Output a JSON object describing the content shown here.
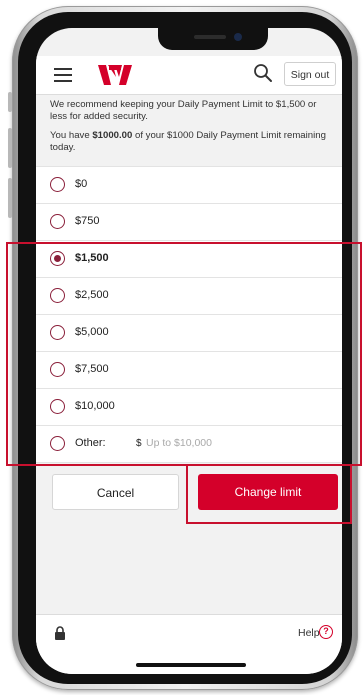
{
  "header": {
    "menu_icon": "hamburger-icon",
    "logo_icon": "westpac-logo-icon",
    "search_icon": "search-icon",
    "signout_label": "Sign out"
  },
  "intro": {
    "recommend_text": "We recommend keeping your Daily Payment Limit to $1,500 or less for added security.",
    "remaining_prefix": "You have ",
    "remaining_amount": "$1000.00",
    "remaining_suffix": " of your $1000 Daily Payment Limit remaining today."
  },
  "options": [
    {
      "label": "$0",
      "selected": false
    },
    {
      "label": "$750",
      "selected": false
    },
    {
      "label": "$1,500",
      "selected": true
    },
    {
      "label": "$2,500",
      "selected": false
    },
    {
      "label": "$5,000",
      "selected": false
    },
    {
      "label": "$7,500",
      "selected": false
    },
    {
      "label": "$10,000",
      "selected": false
    }
  ],
  "other": {
    "label": "Other:",
    "currency": "$",
    "placeholder": "Up to $10,000"
  },
  "actions": {
    "cancel_label": "Cancel",
    "change_label": "Change limit"
  },
  "footer": {
    "lock_icon": "lock-icon",
    "help_label": "Help",
    "help_icon": "help-circle-icon",
    "help_glyph": "?"
  },
  "colors": {
    "brand_red": "#d4002a",
    "radio_color": "#8a1f3a",
    "highlight": "#c8102e"
  }
}
